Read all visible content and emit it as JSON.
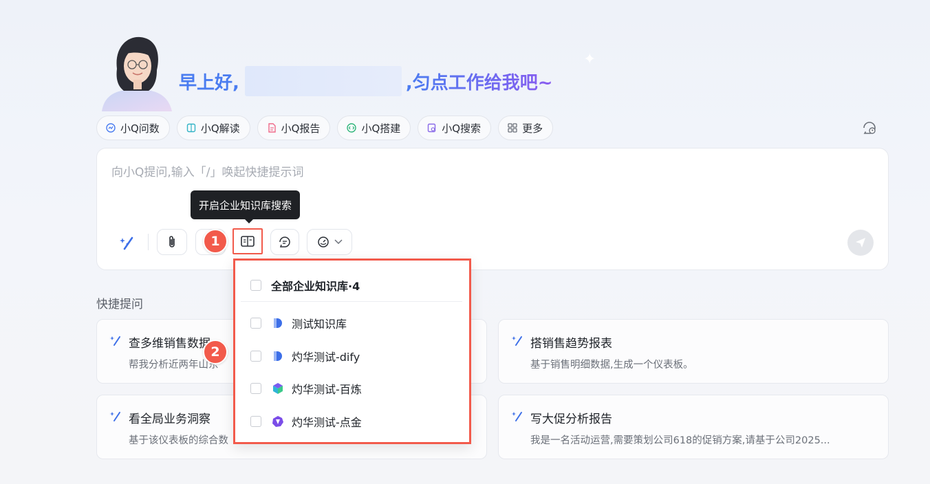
{
  "greeting": {
    "prefix": "早上好,",
    "suffix": ",匀点工作给我吧~"
  },
  "chips": [
    {
      "label": "小Q问数",
      "icon": "chat-data-icon"
    },
    {
      "label": "小Q解读",
      "icon": "book-read-icon"
    },
    {
      "label": "小Q报告",
      "icon": "report-doc-icon"
    },
    {
      "label": "小Q搭建",
      "icon": "build-code-icon"
    },
    {
      "label": "小Q搜索",
      "icon": "search-doc-icon"
    },
    {
      "label": "更多",
      "icon": "grid-more-icon"
    }
  ],
  "input": {
    "placeholder": "向小Q提问,输入「/」唤起快捷提示词"
  },
  "tooltip": {
    "text": "开启企业知识库搜索"
  },
  "badges": {
    "one": "1",
    "two": "2"
  },
  "quick_prompts": {
    "title": "快捷提问",
    "items": [
      {
        "title": "查多维销售数据",
        "desc": "帮我分析近两年山东"
      },
      {
        "title": "搭销售趋势报表",
        "desc": "基于销售明细数据,生成一个仪表板。"
      },
      {
        "title": "看全局业务洞察",
        "desc": "基于该仪表板的综合数"
      },
      {
        "title": "写大促分析报告",
        "desc": "我是一名活动运营,需要策划公司618的促销方案,请基于公司2025..."
      }
    ]
  },
  "knowledge_dropdown": {
    "all_label": "全部企业知识库·4",
    "items": [
      {
        "label": "测试知识库",
        "icon": "blue-d-logo-icon"
      },
      {
        "label": "灼华测试-dify",
        "icon": "blue-d-logo-icon"
      },
      {
        "label": "灼华测试-百炼",
        "icon": "bailian-cube-icon"
      },
      {
        "label": "灼华测试-点金",
        "icon": "dianjin-purple-icon"
      }
    ]
  }
}
